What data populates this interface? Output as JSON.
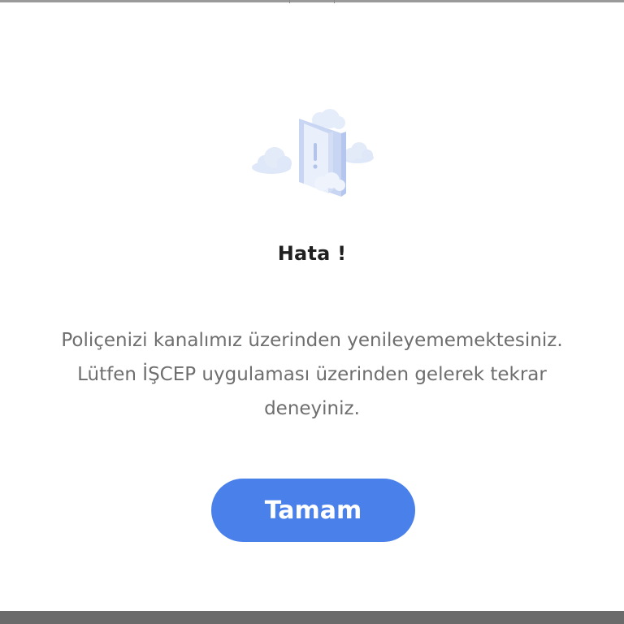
{
  "dialog": {
    "illustration_icon": "error-door-cloud-icon",
    "title": "Hata !",
    "message_lines": [
      "Poliçenizi kanalımız üzerinden yenileyememektesiniz.",
      "Lütfen İŞCEP uygulaması üzerinden gelerek tekrar",
      "deneyiniz."
    ],
    "confirm_label": "Tamam"
  },
  "colors": {
    "primary_button": "#4a80ea",
    "title_text": "#1f1f1f",
    "body_text": "#6e6e6e",
    "illustration": "#dbe5f7"
  }
}
